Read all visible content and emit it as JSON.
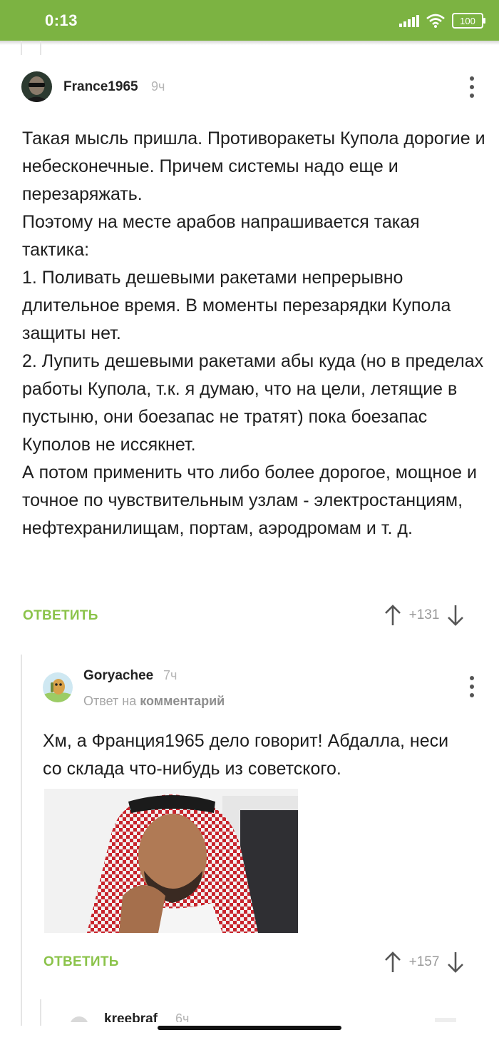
{
  "status_bar": {
    "time": "0:13",
    "battery": "100"
  },
  "comments": [
    {
      "author": "France1965",
      "time": "9ч",
      "paragraphs": [
        "Такая мысль пришла. Противоракеты Купола дорогие и небесконечные. Причем системы надо еще и перезаряжать.",
        "Поэтому на месте арабов напрашивается такая тактика:",
        "1. Поливать дешевыми ракетами непрерывно длительное время. В моменты перезарядки Купола защиты нет.",
        "2. Лупить дешевыми ракетами абы куда (но в пределах работы Купола, т.к. я думаю, что на цели, летящие в пустыню, они боезапас не тратят) пока боезапас Куполов не иссякнет.",
        "А потом применить что либо более дорогое, мощное и точное по чувствительным узлам - электростанциям, нефтехранилищам, портам, аэродромам и т. д."
      ],
      "reply_label": "ОТВЕТИТЬ",
      "score": "+131"
    },
    {
      "author": "Goryachee",
      "time": "7ч",
      "reply_prefix": "Ответ на",
      "reply_target": "комментарий",
      "paragraphs": [
        "Хм, а Франция1965 дело говорит! Абдалла, неси со склада что-нибудь из советского."
      ],
      "reply_label": "ОТВЕТИТЬ",
      "score": "+157"
    }
  ],
  "next_comment": {
    "author": "kreebraf",
    "time": "6ч"
  },
  "colors": {
    "accent": "#7cb342",
    "reply": "#8bc34a",
    "muted": "#b5b5b5"
  },
  "icons": [
    "signal-icon",
    "wifi-icon",
    "battery-icon",
    "more-vert-icon",
    "upvote-arrow-icon",
    "downvote-arrow-icon"
  ]
}
